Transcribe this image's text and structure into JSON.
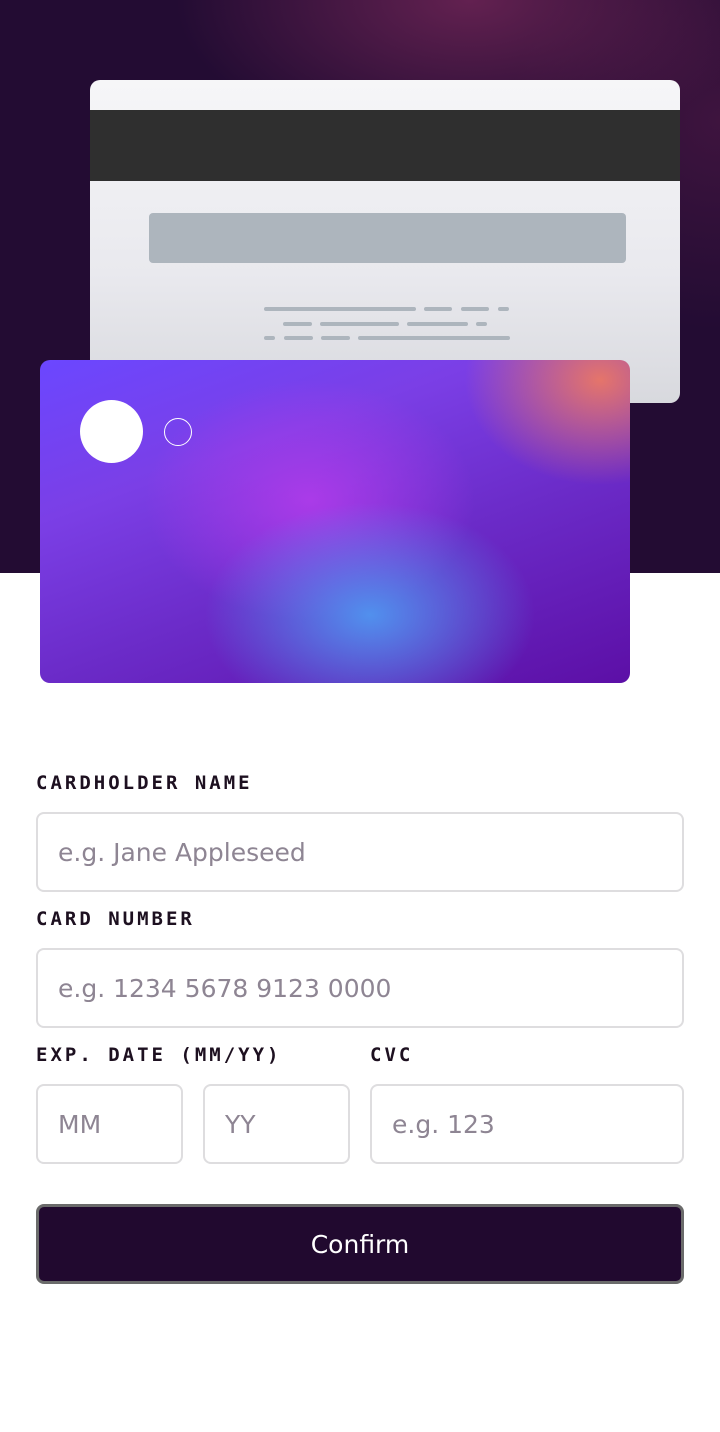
{
  "form": {
    "cardholder_label": "CARDHOLDER NAME",
    "cardholder_placeholder": "e.g. Jane Appleseed",
    "number_label": "CARD NUMBER",
    "number_placeholder": "e.g. 1234 5678 9123 0000",
    "exp_label": "EXP. DATE (MM/YY)",
    "mm_placeholder": "MM",
    "yy_placeholder": "YY",
    "cvc_label": "CVC",
    "cvc_placeholder": "e.g. 123",
    "confirm_label": "Confirm"
  },
  "colors": {
    "hero_bg": "#230c33",
    "button_bg": "#21092f",
    "input_border": "#dedddf",
    "placeholder": "#8e8593"
  }
}
